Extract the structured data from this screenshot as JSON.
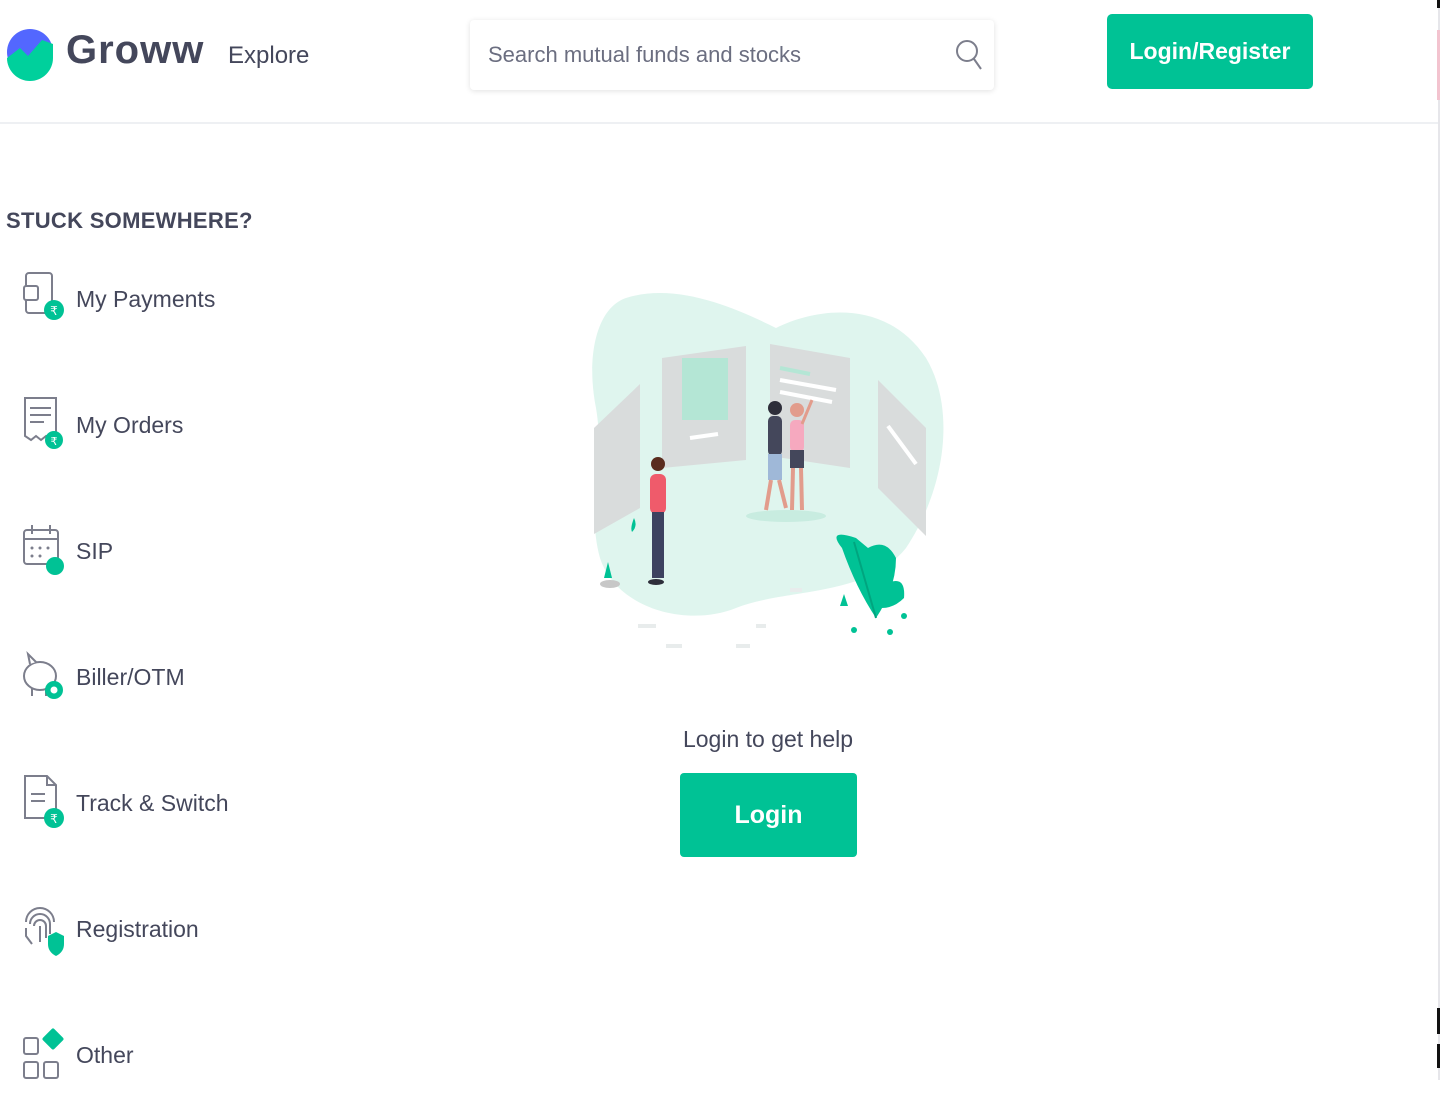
{
  "header": {
    "brand": "Groww",
    "explore_label": "Explore",
    "search_placeholder": "Search mutual funds and stocks",
    "login_register_label": "Login/Register"
  },
  "sidebar": {
    "title": "STUCK SOMEWHERE?",
    "items": [
      {
        "label": "My Payments",
        "icon": "payments-icon"
      },
      {
        "label": "My Orders",
        "icon": "orders-icon"
      },
      {
        "label": "SIP",
        "icon": "calendar-icon"
      },
      {
        "label": "Biller/OTM",
        "icon": "piggy-bank-icon"
      },
      {
        "label": "Track & Switch",
        "icon": "document-rupee-icon"
      },
      {
        "label": "Registration",
        "icon": "fingerprint-icon"
      },
      {
        "label": "Other",
        "icon": "grid-icon"
      }
    ]
  },
  "main": {
    "help_text": "Login to get help",
    "login_label": "Login"
  },
  "colors": {
    "accent": "#00c295",
    "text": "#44475b",
    "illustration_bg": "#dff5ee",
    "logo_blue": "#5367ff"
  }
}
